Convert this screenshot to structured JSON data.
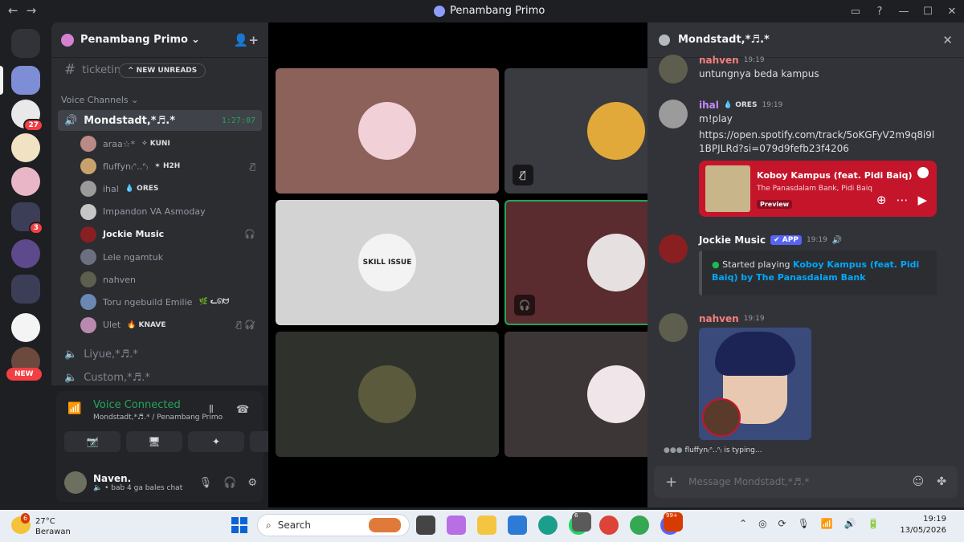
{
  "window": {
    "title": "Penambang Primo",
    "nav_back": "←",
    "nav_forward": "→",
    "controls": [
      "▭",
      "?",
      "—",
      "☐",
      "✕"
    ]
  },
  "servers": {
    "badges": [
      "27",
      "3"
    ],
    "new_label": "NEW"
  },
  "guild": {
    "name": "Penambang Primo",
    "chevron": "⌄",
    "invite_icon": "👤+",
    "text_channel_partial": "ticketin",
    "new_unreads": "^ NEW UNREADS",
    "category": "Voice Channels ⌄",
    "active_voice": {
      "name": "Mondstadt,*♬.*",
      "timer": "1:27:07"
    },
    "voice_users": [
      {
        "name": "araa☆*",
        "tag": "✧ KUNI",
        "right": "",
        "bold": false,
        "color": "#b98a86"
      },
      {
        "name": "fluffyn₍ᐢ‥ᐢ₎",
        "tag": "✶ H2H",
        "right": "🎙̸",
        "bold": false,
        "color": "#c7a36b"
      },
      {
        "name": "ihal",
        "tag": "💧 ORES",
        "right": "",
        "bold": false,
        "color": "#9b9b9b"
      },
      {
        "name": "Impandon VA Asmoday",
        "tag": "",
        "right": "",
        "bold": false,
        "color": "#c6c6c6"
      },
      {
        "name": "Jockie Music",
        "tag": "",
        "right": "🎧",
        "bold": true,
        "color": "#8a1f22"
      },
      {
        "name": "Lele ngamtuk",
        "tag": "",
        "right": "",
        "bold": false,
        "color": "#6b6f80"
      },
      {
        "name": "nahven",
        "tag": "",
        "right": "",
        "bold": false,
        "color": "#5d5e4e"
      },
      {
        "name": "Toru ngebuild Emilie",
        "tag": "🌿 ᓚᘏᗢ",
        "right": "",
        "bold": false,
        "color": "#6b88b3"
      },
      {
        "name": "Ulet",
        "tag": "🔥 KNAVE",
        "right": "🎙̸ 🎧̸",
        "bold": false,
        "color": "#b98ab0"
      }
    ],
    "other_voice": [
      "Liyue,*♬.*",
      "Custom,*♬.*"
    ]
  },
  "voice_panel": {
    "status": "Voice Connected",
    "channel": "Mondstadt,*♬.* / Penambang Primo",
    "buttons": [
      "📷̸",
      "🖥",
      "✦",
      "✺"
    ]
  },
  "user": {
    "name": "Naven.",
    "status": "🔈 • bab 4 ga bales chat"
  },
  "stage": {
    "tiles": [
      {
        "bg": "#8c615a",
        "av": "#f2d0d8",
        "label": "",
        "icon": ""
      },
      {
        "bg": "#3a3b40",
        "av": "#e0a93a",
        "label": "",
        "icon": "🎙̸"
      },
      {
        "bg": "#d3d3d3",
        "av": "#f3f3f3",
        "label": "SKILL ISSUE",
        "icon": ""
      },
      {
        "bg": "#5a2c2f",
        "av": "#e6e0e0",
        "label": "",
        "icon": "🎧"
      },
      {
        "bg": "#2f322c",
        "av": "#5b5a3c",
        "label": "",
        "icon": ""
      },
      {
        "bg": "#3d3637",
        "av": "#f0e6ea",
        "label": "",
        "icon": ""
      }
    ]
  },
  "chat": {
    "channel": "Mondstadt,*♬.*",
    "messages": {
      "m1": {
        "author": "nahven",
        "time": "19:19",
        "text": "untungnya beda kampus"
      },
      "m2": {
        "author": "ihal",
        "tag": "💧 ORES",
        "time": "19:19",
        "text": "m!play",
        "link": "https://open.spotify.com/track/5oKGFyV2m9q8i9l1BPJLRd?si=079d9fefb23f4206"
      },
      "spotify": {
        "title": "Koboy Kampus (feat. Pidi Baiq)",
        "artist": "The Panasdalam Bank, Pidi Baiq",
        "preview": "Preview"
      },
      "m3": {
        "author": "Jockie Music",
        "badge": "✔ APP",
        "time": "19:19",
        "embed_prefix": "Started playing ",
        "embed_link": "Koboy Kampus (feat. Pidi Baiq) by The Panasdalam Bank"
      },
      "m4": {
        "author": "nahven",
        "time": "19:19"
      }
    },
    "typing": "fluffyn₍ᐢ‥ᐢ₎ is typing...",
    "composer_placeholder": "Message Mondstadt,*♬.*"
  },
  "taskbar": {
    "weather_badge": "6",
    "temp": "27°C",
    "condition": "Berawan",
    "search": "Search",
    "app_badges": [
      "6",
      "99+"
    ],
    "time": "19:19",
    "date": "13/05/2026"
  },
  "colors": {
    "accent": "#5865f2",
    "online": "#23a55a",
    "danger": "#f23f43",
    "link": "#00a8fc",
    "spotify_embed": "#c4152b",
    "name_red": "#f47f7f",
    "name_purple": "#c58af9"
  }
}
